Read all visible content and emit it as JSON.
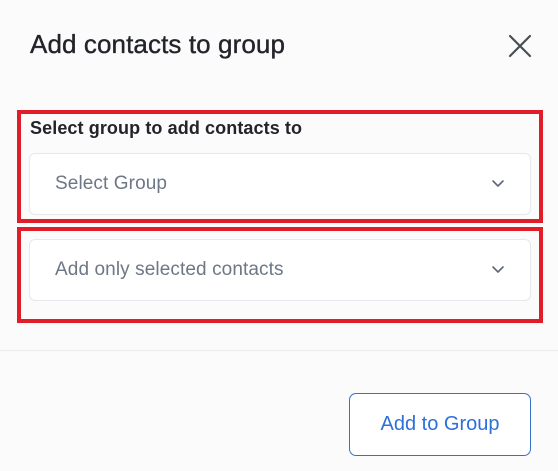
{
  "dialog": {
    "title": "Add contacts to group"
  },
  "group_field": {
    "label": "Select group to add contacts to",
    "selected": "Select Group"
  },
  "scope_field": {
    "selected": "Add only selected contacts"
  },
  "footer": {
    "submit_label": "Add to Group"
  },
  "colors": {
    "highlight": "#e11d2a",
    "accent": "#2f6fd8",
    "title_text": "#222429",
    "placeholder_text": "#6d7785"
  },
  "icons": {
    "close": "close-icon",
    "dropdown": "chevron-down-icon"
  }
}
